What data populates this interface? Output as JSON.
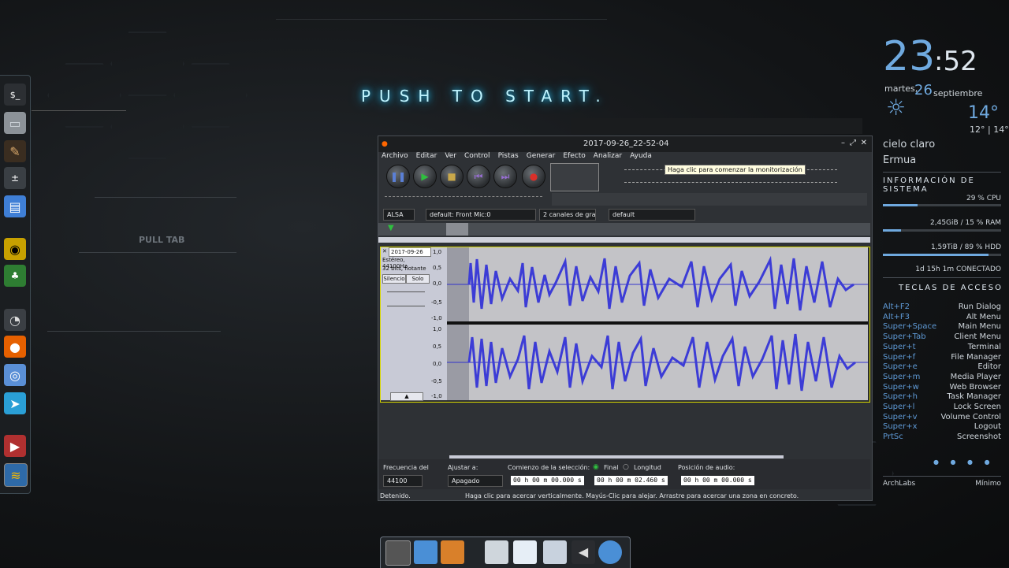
{
  "background": {
    "banner": "PUSH TO START.",
    "pull_tab": "PULL TAB"
  },
  "audacity": {
    "title": "2017-09-26_22-52-04",
    "menu": [
      "Archivo",
      "Editar",
      "Ver",
      "Control",
      "Pistas",
      "Generar",
      "Efecto",
      "Analizar",
      "Ayuda"
    ],
    "tooltip": "Haga clic para comenzar la monitorización",
    "device_host": "ALSA",
    "device_input": "default: Front Mic:0",
    "device_channels": "2 canales de gra",
    "device_output": "default",
    "track": {
      "name": "2017-09-26",
      "info1": "Estéreo, 44100Hz",
      "info2": "32 bits, flotante",
      "mute": "Silencio",
      "solo": "Solo"
    },
    "scale": [
      "1,0",
      "0,5",
      "0,0",
      "-0,5",
      "-1,0"
    ],
    "status": {
      "rate_label": "Frecuencia del",
      "rate_value": "44100",
      "snap_label": "Ajustar a:",
      "snap_value": "Apagado",
      "sel_label": "Comienzo de la selección:",
      "end_label": "Final",
      "len_label": "Longitud",
      "pos_label": "Posición de audio:",
      "sel_start": "00 h 00 m 00.000 s",
      "sel_end": "00 h 00 m 02.460 s",
      "pos": "00 h 00 m 00.000 s",
      "state": "Detenido.",
      "hint": "Haga clic para acercar verticalmente. Mayús-Clic para alejar. Arrastre para acercar una zona en concreto."
    }
  },
  "conky": {
    "hour": "23",
    "minute": ":52",
    "weekday": "martes,",
    "day": "26",
    "month": "septiembre",
    "temp": "14°",
    "temp_range": "12° | 14°",
    "sky": "cielo claro",
    "city": "Ermua",
    "sys_title": "INFORMACIÓN DE SISTEMA",
    "cpu": "29 % CPU",
    "cpu_pct": 29,
    "ram": "2,45GiB / 15 % RAM",
    "ram_pct": 15,
    "hdd": "1,59TiB / 89 % HDD",
    "hdd_pct": 89,
    "uptime": "1d 15h 1m CONECTADO",
    "keys_title": "TECLAS DE ACCESO",
    "keys": [
      {
        "k": "Alt+F2",
        "a": "Run Dialog"
      },
      {
        "k": "Alt+F3",
        "a": "Alt Menu"
      },
      {
        "k": "Super+Space",
        "a": "Main Menu"
      },
      {
        "k": "Super+Tab",
        "a": "Client Menu"
      },
      {
        "k": "Super+t",
        "a": "Terminal"
      },
      {
        "k": "Super+f",
        "a": "File Manager"
      },
      {
        "k": "Super+e",
        "a": "Editor"
      },
      {
        "k": "Super+m",
        "a": "Media Player"
      },
      {
        "k": "Super+w",
        "a": "Web Browser"
      },
      {
        "k": "Super+h",
        "a": "Task Manager"
      },
      {
        "k": "Super+l",
        "a": "Lock Screen"
      },
      {
        "k": "Super+v",
        "a": "Volume Control"
      },
      {
        "k": "Super+x",
        "a": "Logout"
      },
      {
        "k": "PrtSc",
        "a": "Screenshot"
      }
    ],
    "footer_left": "ArchLabs",
    "footer_right": "Mínimo"
  }
}
